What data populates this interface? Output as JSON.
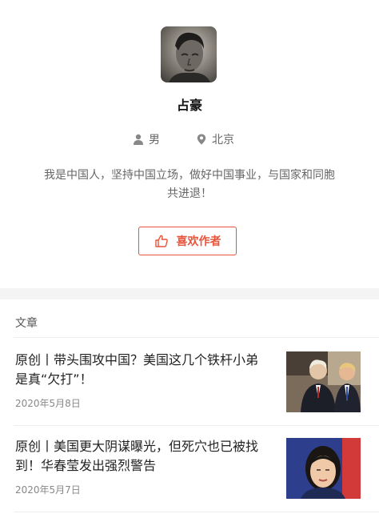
{
  "profile": {
    "name": "占豪",
    "gender": "男",
    "location": "北京",
    "bio_line1": "我是中国人，坚持中国立场，做好中国事业，与国家和同胞",
    "bio_line2": "共进退！",
    "like_button_label": "喜欢作者"
  },
  "colors": {
    "accent": "#e8533a",
    "muted_text": "#666666",
    "divider": "#f4f4f4"
  },
  "articles_section": {
    "title": "文章",
    "items": [
      {
        "title_line1": "原创丨带头围攻中国？美国这几个铁杆小弟",
        "title_line2": "是真“欠打”！",
        "date": "2020年5月8日",
        "thumb_icon": "two-politicians-photo"
      },
      {
        "title_line1": "原创丨美国更大阴谋曝光，但死穴也已被找",
        "title_line2": "到！华春莹发出强烈警告",
        "date": "2020年5月7日",
        "thumb_icon": "spokeswoman-photo"
      }
    ]
  }
}
